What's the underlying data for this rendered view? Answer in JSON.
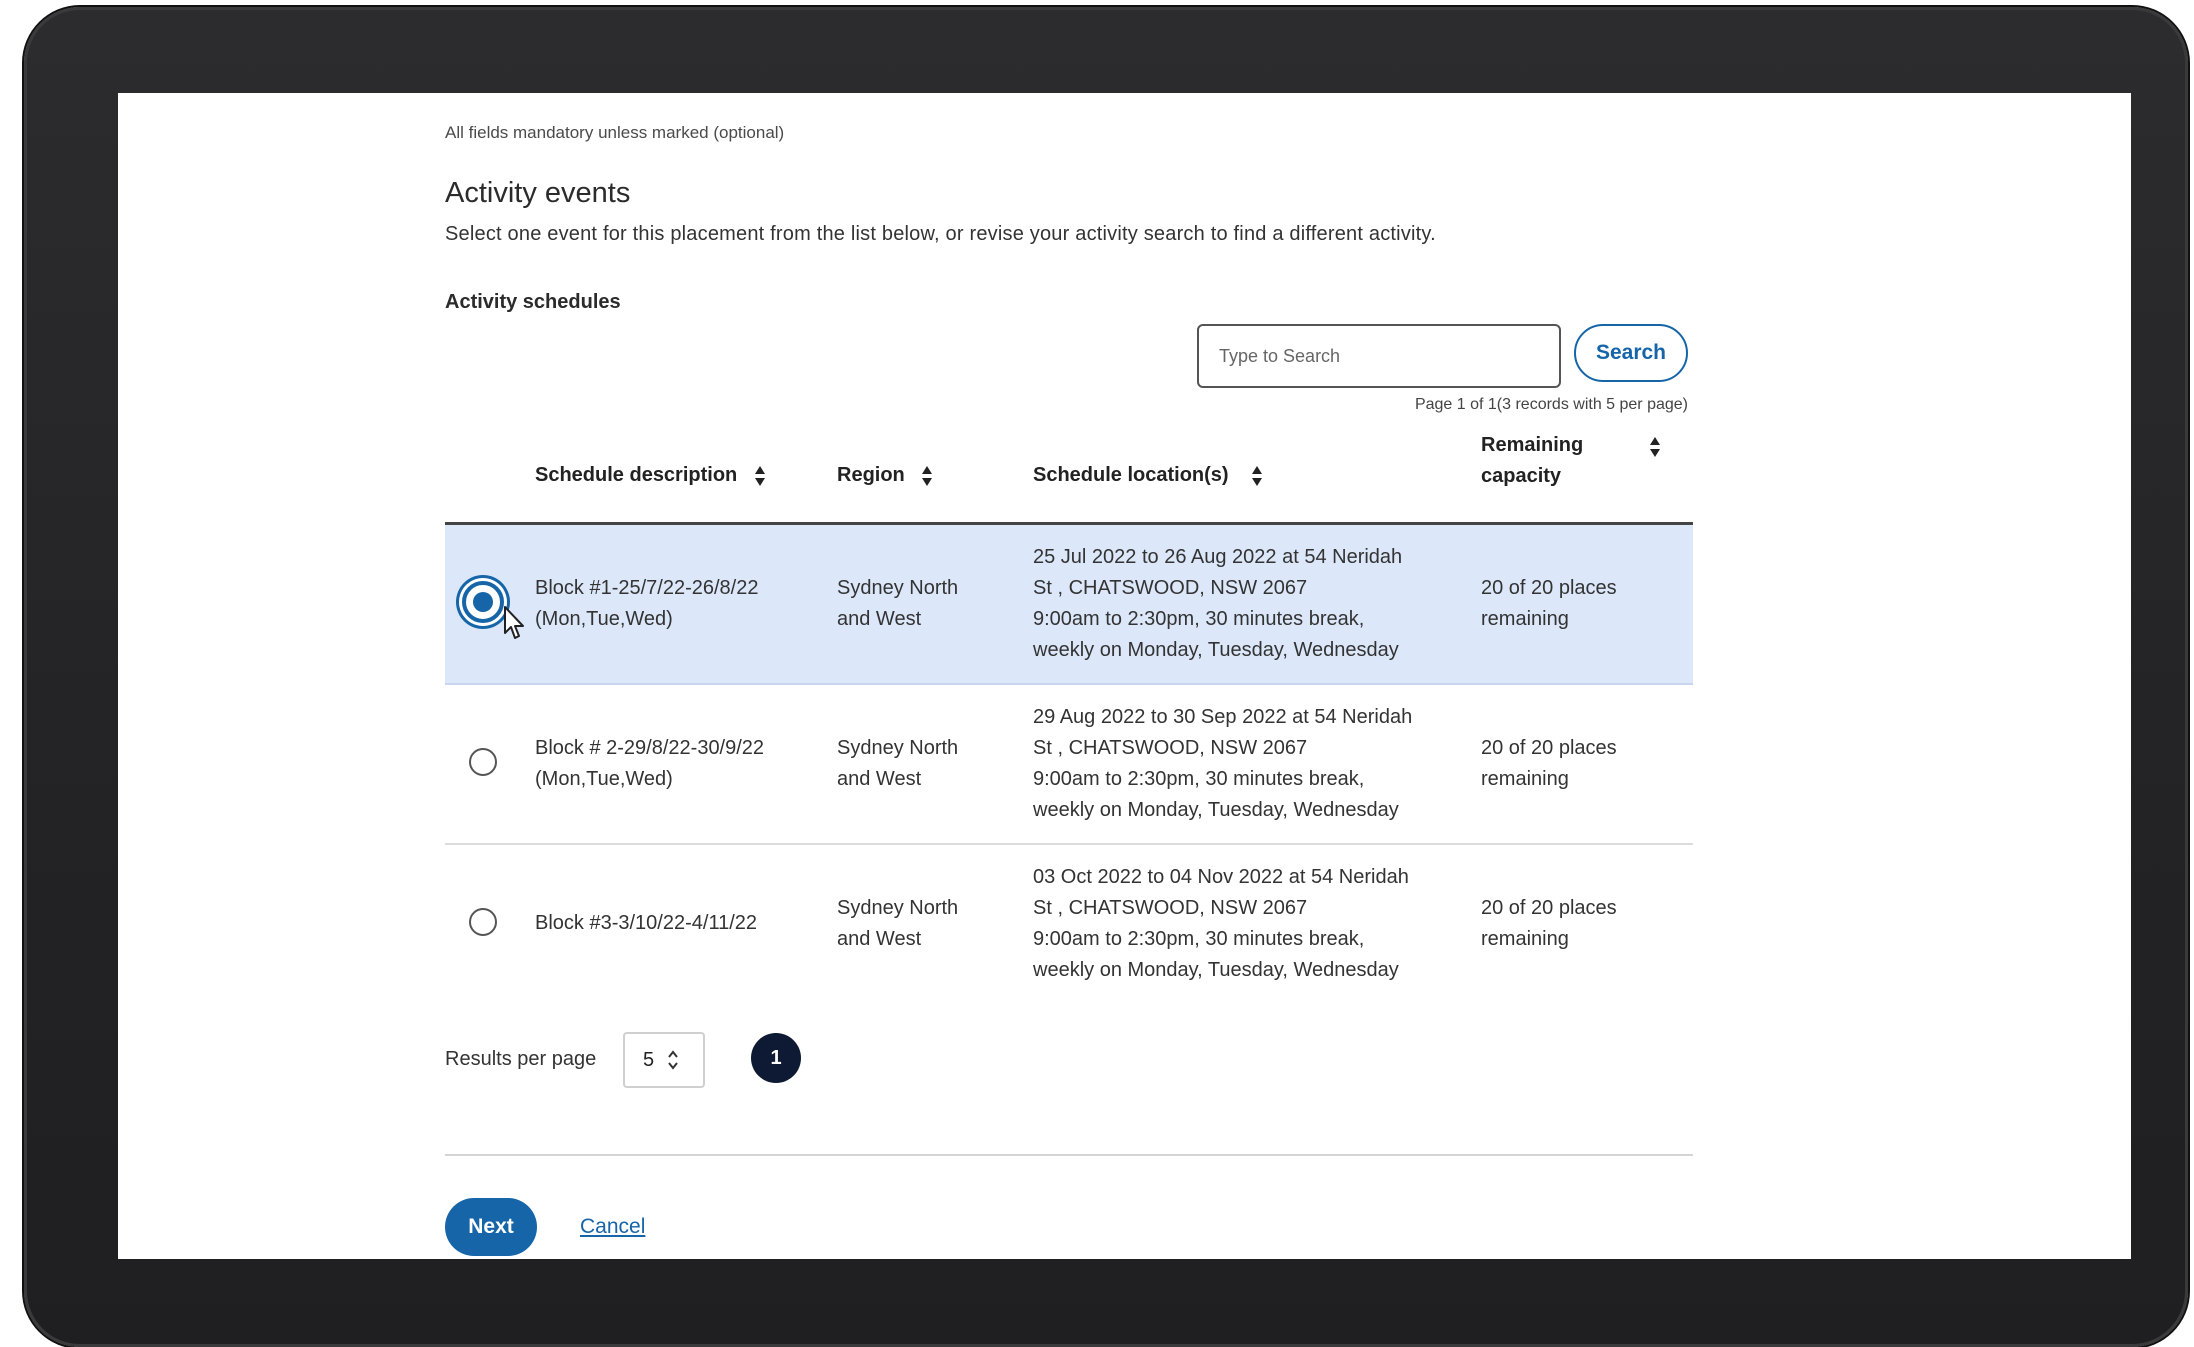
{
  "form": {
    "mandatory_note": "All fields mandatory unless marked (optional)",
    "title": "Activity events",
    "intro": "Select one event for this placement from the list below, or revise your activity search to find a different activity.",
    "section_label": "Activity schedules"
  },
  "search": {
    "placeholder": "Type to Search",
    "value": "",
    "button_label": "Search",
    "page_info": "Page 1 of 1(3 records with 5 per page)"
  },
  "table": {
    "headers": {
      "description": "Schedule description",
      "region": "Region",
      "location": "Schedule location(s)",
      "capacity_line1": "Remaining",
      "capacity_line2": "capacity"
    },
    "rows": [
      {
        "selected": true,
        "description_line1": "Block #1-25/7/22-26/8/22",
        "description_line2": "(Mon,Tue,Wed)",
        "region_line1": "Sydney North",
        "region_line2": "and West",
        "location_line1": "25 Jul 2022 to 26 Aug 2022 at 54 Neridah",
        "location_line2": "St , CHATSWOOD, NSW 2067",
        "location_line3": "9:00am to 2:30pm, 30 minutes break,",
        "location_line4": "weekly on Monday, Tuesday, Wednesday",
        "capacity_line1": "20 of 20 places",
        "capacity_line2": "remaining"
      },
      {
        "selected": false,
        "description_line1": "Block # 2-29/8/22-30/9/22",
        "description_line2": "(Mon,Tue,Wed)",
        "region_line1": "Sydney North",
        "region_line2": "and West",
        "location_line1": "29 Aug 2022 to 30 Sep 2022 at 54 Neridah",
        "location_line2": "St , CHATSWOOD, NSW 2067",
        "location_line3": "9:00am to 2:30pm, 30 minutes break,",
        "location_line4": "weekly on Monday, Tuesday, Wednesday",
        "capacity_line1": "20 of 20 places",
        "capacity_line2": "remaining"
      },
      {
        "selected": false,
        "description_line1": "Block #3-3/10/22-4/11/22",
        "description_line2": "",
        "region_line1": "Sydney North",
        "region_line2": "and West",
        "location_line1": "03 Oct 2022 to 04 Nov 2022 at 54 Neridah",
        "location_line2": "St , CHATSWOOD, NSW 2067",
        "location_line3": "9:00am to 2:30pm, 30 minutes break,",
        "location_line4": "weekly on Monday, Tuesday, Wednesday",
        "capacity_line1": "20 of 20 places",
        "capacity_line2": "remaining"
      }
    ]
  },
  "pagination": {
    "results_per_page_label": "Results per page",
    "results_per_page_value": "5",
    "current_page": "1"
  },
  "actions": {
    "next_label": "Next",
    "cancel_label": "Cancel"
  },
  "colors": {
    "accent": "#1565a8",
    "selected_row": "#dce8fa",
    "page_button": "#0e1a33",
    "device_bezel": "#2c2c2e"
  },
  "icons": {
    "sort": "sort-up-down-icon",
    "cursor": "mouse-pointer-icon",
    "select_chevrons": "chevron-up-down-icon"
  }
}
